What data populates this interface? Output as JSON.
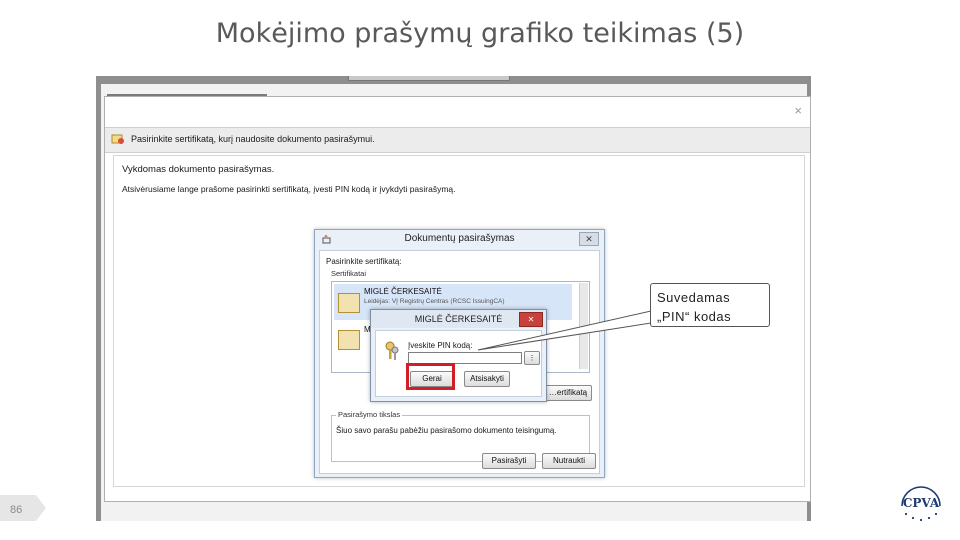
{
  "slide": {
    "title": "Mokėjimo prašymų grafiko teikimas (5)",
    "page_number": "86",
    "logo_text": "CPVA"
  },
  "main_window": {
    "close_glyph": "×",
    "header": "Pasirinkite sertifikatą, kurį naudosite dokumento pasirašymui.",
    "heading": "Vykdomas dokumento pasirašymas.",
    "text": "Atsivėrusiame lange prašome pasirinkti sertifikatą, įvesti PIN kodą ir įvykdyti pasirašymą."
  },
  "sign_dialog": {
    "title": "Dokumentų pasirašymas",
    "close_glyph": "✕",
    "choose_label": "Pasirinkite sertifikatą:",
    "cert_group_label": "Sertifikatai",
    "cert_name": "MIGLĖ ČERKESAITĖ",
    "cert_detail": "Leidėjas: VĮ Registrų Centras (RCSC IssuingCA)",
    "cert_name_2": "M",
    "detail_button": "…ertifikatą",
    "reason_label": "Pasirašymo tikslas",
    "reason_text": "Šiuo savo parašu pabėžiu pasirašomo dokumento teisingumą.",
    "sign_button": "Pasirašyti",
    "cancel_button": "Nutraukti"
  },
  "pin_dialog": {
    "title": "MIGLĖ ČERKESAITĖ",
    "close_glyph": "✕",
    "pin_label": "Įveskite PIN kodą:",
    "keyboard_button": "⋮",
    "ok_button": "Gerai",
    "cancel_button": "Atsisakyti"
  },
  "callout": {
    "line1": "Suvedamas",
    "line2": "„PIN“ kodas"
  },
  "colors": {
    "highlight": "#d01f26",
    "dialog_bg": "#eaf0f8",
    "pin_close": "#c9413b",
    "title_text": "#595959"
  }
}
